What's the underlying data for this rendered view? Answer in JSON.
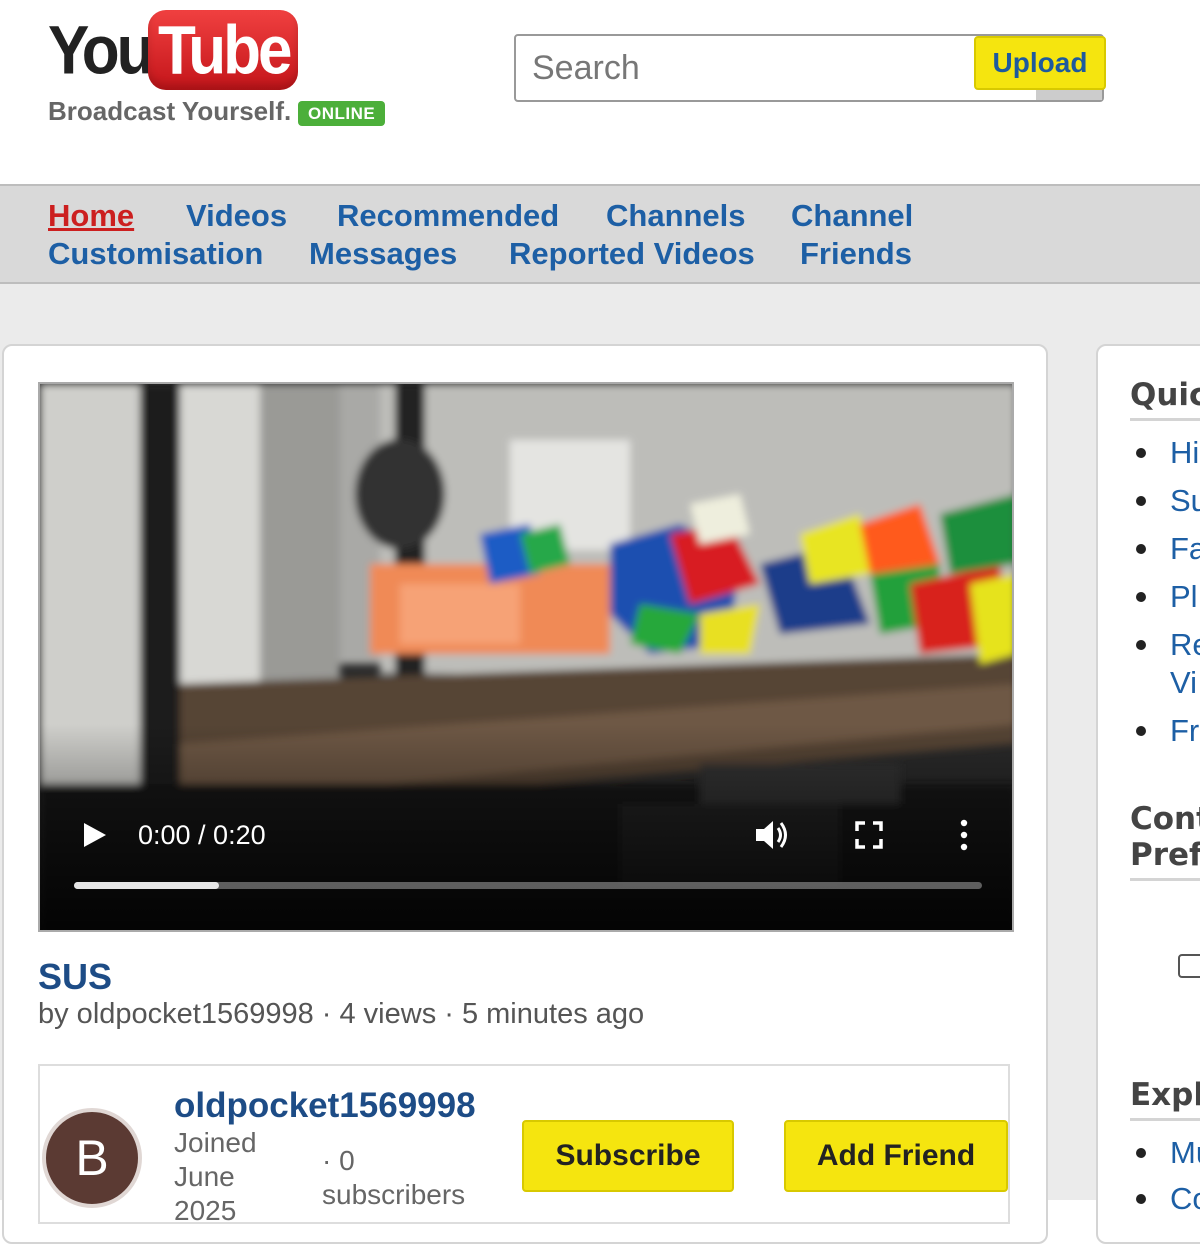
{
  "header": {
    "logo_you": "You",
    "logo_tube": "Tube",
    "tagline": "Broadcast Yourself.",
    "online_badge": "ONLINE",
    "search_placeholder": "Search",
    "upload_label": "Upload"
  },
  "nav": {
    "items": [
      {
        "label": "Home",
        "active": true
      },
      {
        "label": "Videos"
      },
      {
        "label": "Recommended"
      },
      {
        "label": "Channels"
      },
      {
        "label": "Channel"
      },
      {
        "label": "Customisation"
      },
      {
        "label": "Messages"
      },
      {
        "label": "Reported Videos"
      },
      {
        "label": "Friends"
      }
    ]
  },
  "player": {
    "time": "0:00 / 0:20",
    "progress_fraction": 0.16
  },
  "video": {
    "title": "SUS",
    "meta": "by oldpocket1569998 · 4 views · 5 minutes ago"
  },
  "channel": {
    "avatar_letter": "B",
    "name": "oldpocket1569998",
    "joined": "Joined June 2025",
    "subscribers": "· 0 subscribers",
    "subscribe_label": "Subscribe",
    "add_friend_label": "Add Friend"
  },
  "sidebar": {
    "quick_heading": "Quic",
    "quick_links": [
      "Hi",
      "Su",
      "Fa",
      "Pl",
      "Re",
      "Vi",
      "Fr"
    ],
    "content_heading_1": "Cont",
    "content_heading_2": "Pref",
    "explore_heading": "Expl",
    "explore_links": [
      "Mu",
      "Co"
    ]
  },
  "colors": {
    "link": "#1d5fa5",
    "active_nav": "#cc1f1f",
    "button_yellow": "#f5e50f",
    "online_green": "#4caf3a",
    "logo_red": "#d62b2b"
  }
}
